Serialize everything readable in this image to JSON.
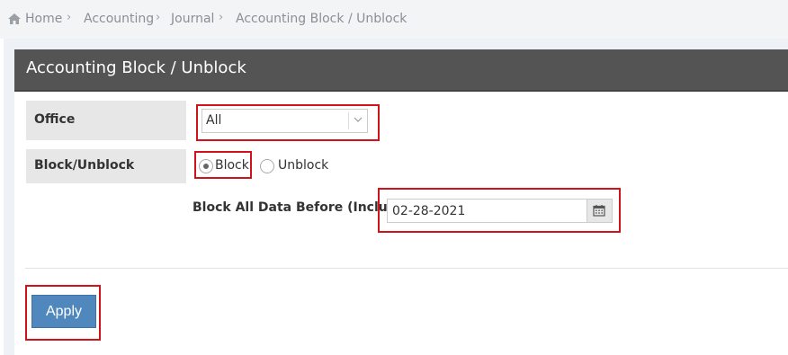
{
  "breadcrumb": {
    "items": [
      "Home",
      "Accounting",
      "Journal",
      "Accounting Block / Unblock"
    ]
  },
  "panel": {
    "title": "Accounting Block / Unblock"
  },
  "form": {
    "office_label": "Office",
    "office_value": "All",
    "block_label": "Block/Unblock",
    "block_option": "Block",
    "unblock_option": "Unblock",
    "selected": "Block",
    "date_label": "Block All Data Before (Including)",
    "date_value": "02-28-2021"
  },
  "actions": {
    "apply_label": "Apply"
  },
  "colors": {
    "header_bg": "#545454",
    "button_bg": "#5087bd",
    "highlight": "#d0121b"
  },
  "icons": [
    "home-icon",
    "chevron-right-icon",
    "chevron-down-icon",
    "calendar-icon"
  ]
}
